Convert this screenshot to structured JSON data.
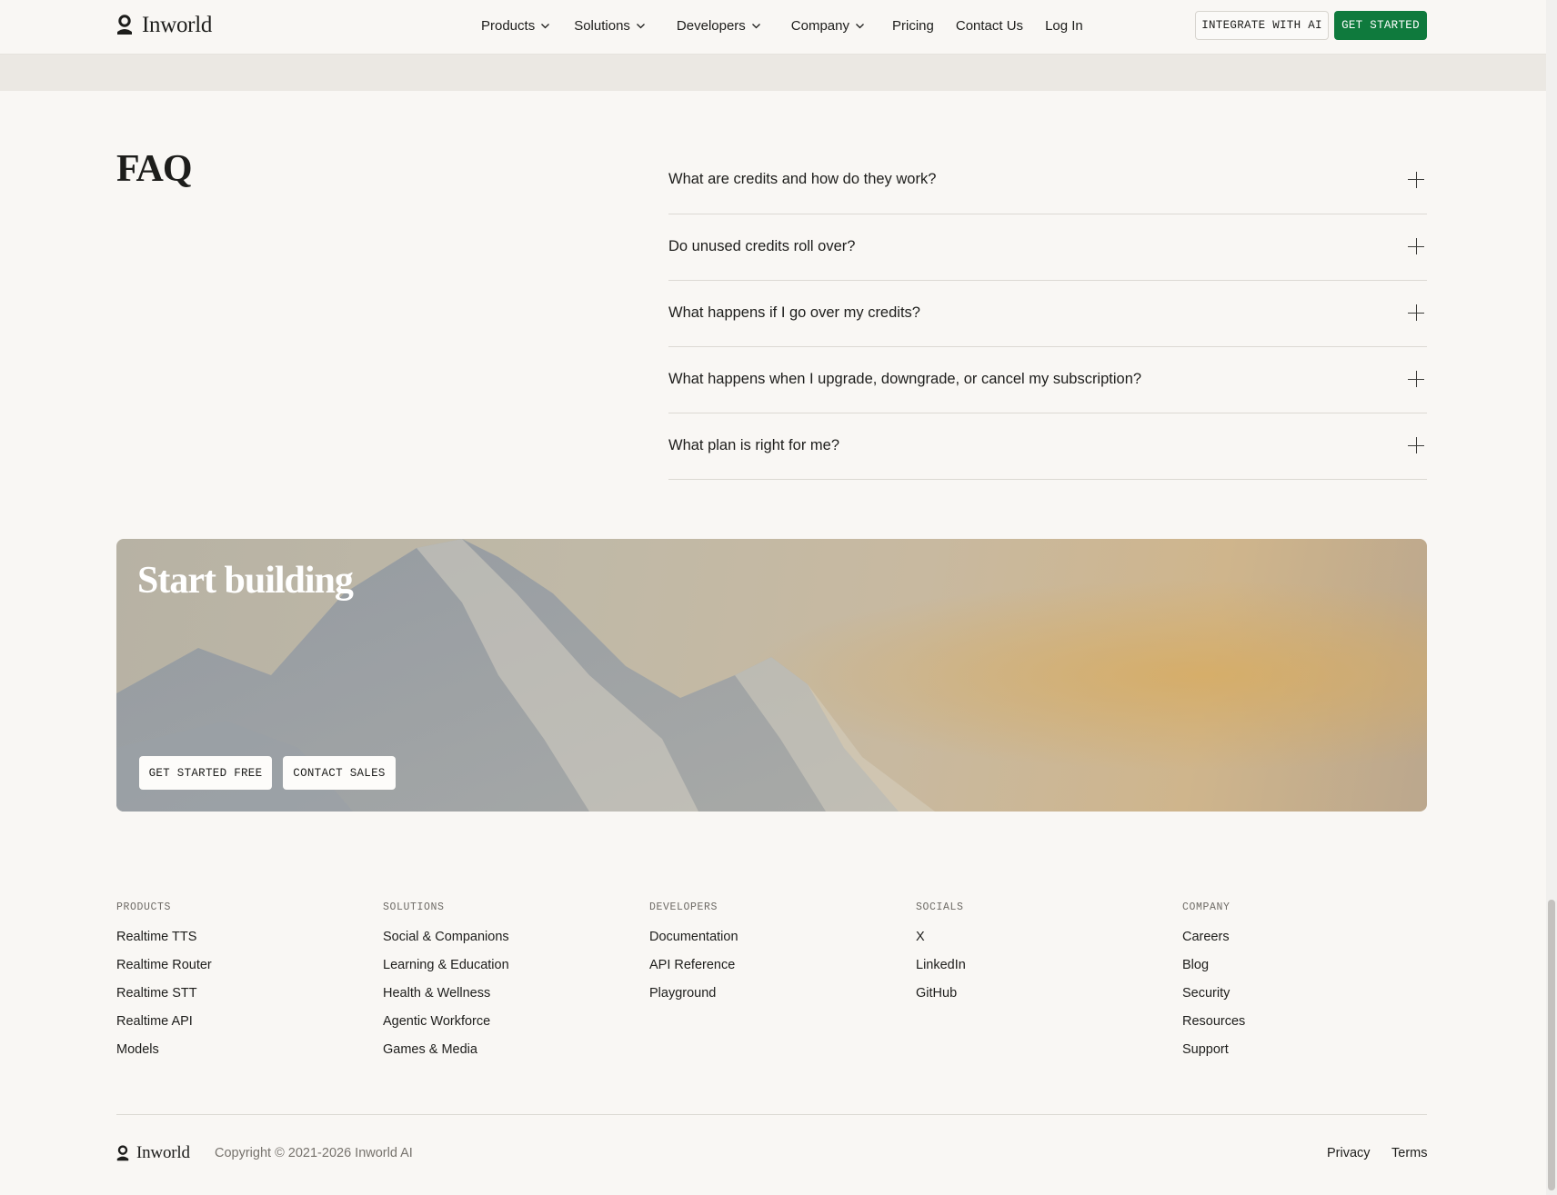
{
  "brand": {
    "name": "Inworld"
  },
  "nav": {
    "items": [
      {
        "label": "Products",
        "dropdown": true
      },
      {
        "label": "Solutions",
        "dropdown": true
      },
      {
        "label": "Developers",
        "dropdown": true
      },
      {
        "label": "Company",
        "dropdown": true
      },
      {
        "label": "Pricing",
        "dropdown": false
      },
      {
        "label": "Contact Us",
        "dropdown": false
      },
      {
        "label": "Log In",
        "dropdown": false
      }
    ],
    "integrate_label": "INTEGRATE WITH AI",
    "get_started_label": "GET STARTED"
  },
  "faq": {
    "title": "FAQ",
    "questions": [
      "What are credits and how do they work?",
      "Do unused credits roll over?",
      "What happens if I go over my credits?",
      "What happens when I upgrade, downgrade, or cancel my subscription?",
      "What plan is right for me?"
    ]
  },
  "cta": {
    "title": "Start building",
    "primary_label": "GET STARTED FREE",
    "secondary_label": "CONTACT SALES"
  },
  "footer": {
    "columns": [
      {
        "heading": "PRODUCTS",
        "links": [
          "Realtime TTS",
          "Realtime Router",
          "Realtime STT",
          "Realtime API",
          "Models"
        ]
      },
      {
        "heading": "SOLUTIONS",
        "links": [
          "Social & Companions",
          "Learning & Education",
          "Health & Wellness",
          "Agentic Workforce",
          "Games & Media"
        ]
      },
      {
        "heading": "DEVELOPERS",
        "links": [
          "Documentation",
          "API Reference",
          "Playground"
        ]
      },
      {
        "heading": "SOCIALS",
        "links": [
          "X",
          "LinkedIn",
          "GitHub"
        ]
      },
      {
        "heading": "COMPANY",
        "links": [
          "Careers",
          "Blog",
          "Security",
          "Resources",
          "Support"
        ]
      }
    ],
    "copyright": "Copyright © 2021-2026 Inworld AI",
    "privacy_label": "Privacy",
    "terms_label": "Terms"
  },
  "colors": {
    "accent_green": "#0f7a3d",
    "background": "#f9f7f4",
    "band": "#ebe8e3"
  },
  "icons": {
    "dropdown": "chevron-down-icon",
    "expand": "plus-icon",
    "logo": "inworld-logo-icon"
  }
}
